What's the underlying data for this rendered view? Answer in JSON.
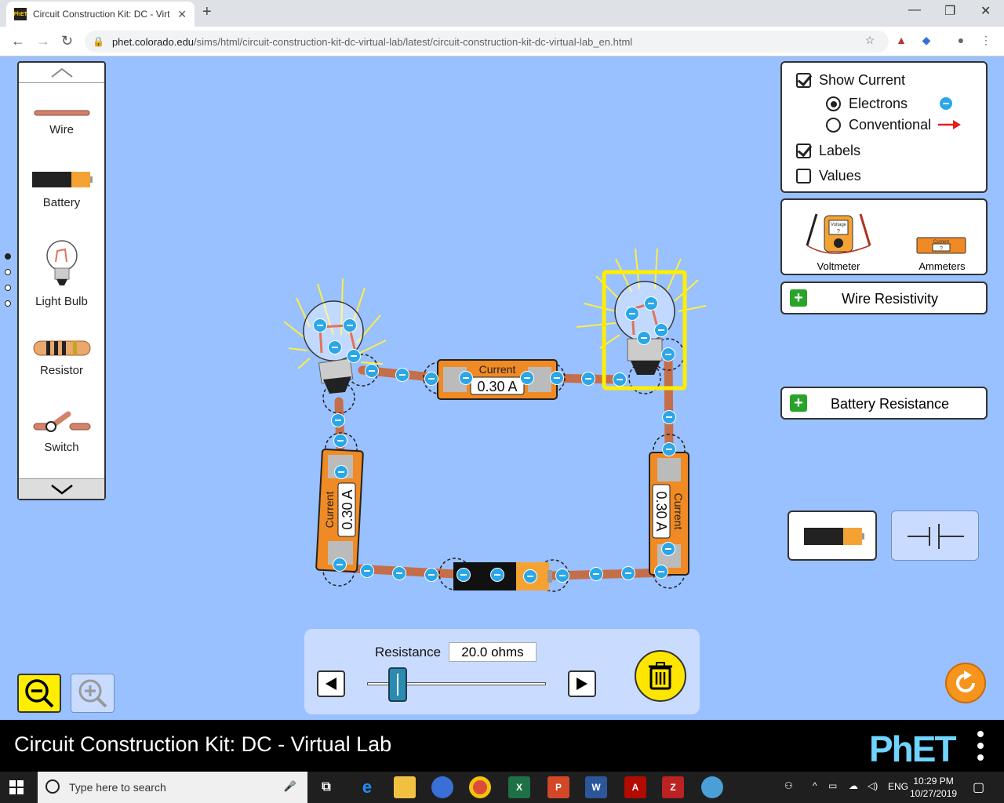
{
  "browser": {
    "tab_title": "Circuit Construction Kit: DC - Virt",
    "tab_favicon": "PhET",
    "url_host": "phet.colorado.edu",
    "url_path": "/sims/html/circuit-construction-kit-dc-virtual-lab/latest/circuit-construction-kit-dc-virtual-lab_en.html"
  },
  "toolbox": {
    "items": [
      {
        "label": "Wire"
      },
      {
        "label": "Battery"
      },
      {
        "label": "Light Bulb"
      },
      {
        "label": "Resistor"
      },
      {
        "label": "Switch"
      }
    ]
  },
  "display_panel": {
    "show_current": {
      "label": "Show Current",
      "checked": true
    },
    "electrons": {
      "label": "Electrons",
      "selected": true
    },
    "conventional": {
      "label": "Conventional",
      "selected": false
    },
    "labels": {
      "label": "Labels",
      "checked": true
    },
    "values": {
      "label": "Values",
      "checked": false
    }
  },
  "meters": {
    "voltmeter": "Voltmeter",
    "ammeters": "Ammeters",
    "voltmeter_screen": "Voltage",
    "ammeter_screen": "Current",
    "unknown": "?"
  },
  "wire_resistivity": "Wire Resistivity",
  "battery_resistance": "Battery Resistance",
  "ammeter_readings": {
    "label": "Current",
    "top": "0.30 A",
    "left": "0.30 A",
    "right": "0.30 A"
  },
  "resistance_control": {
    "label": "Resistance",
    "value": "20.0 ohms"
  },
  "footer": {
    "title": "Circuit Construction Kit: DC - Virtual Lab",
    "logo": "PhET"
  },
  "taskbar": {
    "search_placeholder": "Type here to search",
    "language": "ENG",
    "time": "10:29 PM",
    "date": "10/27/2019"
  },
  "colors": {
    "background": "#99c0ff",
    "wire": "#c46e4a",
    "ammeter": "#f08a24",
    "electron": "#2aa7e8",
    "highlight": "#ffee00"
  }
}
